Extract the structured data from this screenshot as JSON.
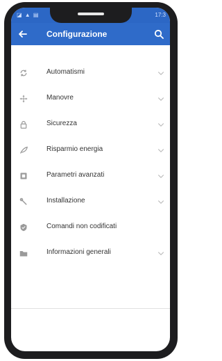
{
  "status_bar": {
    "left_icons": "◪ ▲ ▤",
    "time": "17:3"
  },
  "app_bar": {
    "title": "Configurazione"
  },
  "menu": [
    {
      "label": "Automatismi",
      "icon": "cycle-icon",
      "expandable": true
    },
    {
      "label": "Manovre",
      "icon": "arrows-icon",
      "expandable": true
    },
    {
      "label": "Sicurezza",
      "icon": "lock-icon",
      "expandable": true
    },
    {
      "label": "Risparmio energia",
      "icon": "leaf-icon",
      "expandable": true
    },
    {
      "label": "Parametri avanzati",
      "icon": "advanced-icon",
      "expandable": true
    },
    {
      "label": "Installazione",
      "icon": "wrench-icon",
      "expandable": true
    },
    {
      "label": "Comandi non codificati",
      "icon": "shield-icon",
      "expandable": false
    },
    {
      "label": "Informazioni generali",
      "icon": "folder-icon",
      "expandable": true
    }
  ],
  "colors": {
    "primary": "#2f6bc9",
    "text": "#333333",
    "icon": "#9a9a9a"
  }
}
